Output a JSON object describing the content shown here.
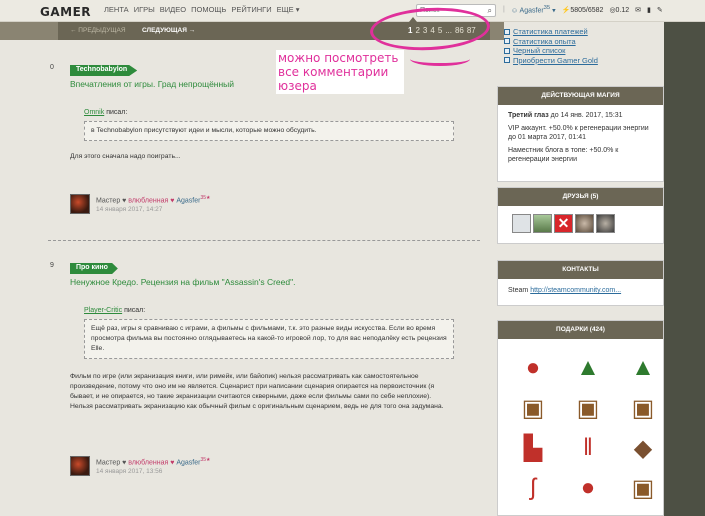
{
  "header": {
    "logo": "GAMER",
    "nav": [
      "ЛЕНТА",
      "ИГРЫ",
      "ВИДЕО",
      "ПОМОЩЬ",
      "РЕЙТИНГИ",
      "ЕЩЕ"
    ],
    "search_placeholder": "Поиск",
    "user": "Agasfer",
    "user_level": "35",
    "counter": "5805/6582",
    "balance": "0.12"
  },
  "pager": {
    "prev": "← ПРЕДЫДУЩАЯ",
    "next": "СЛЕДУЮЩАЯ →",
    "pages": [
      "1",
      "2",
      "3",
      "4",
      "5",
      "...",
      "86",
      "87"
    ],
    "current": "1"
  },
  "annotation": "можно посмотреть все комментарии юзера",
  "posts": [
    {
      "count": "0",
      "tag": "Technobabylon",
      "title": "Впечатления от игры. Град непрощённый",
      "quote_author": "Omnik",
      "wrote": "писал:",
      "quote": "в Technobabylon присутствуют идеи и мысли, которые можно обсудить.",
      "body": "Для этого сначала надо поиграть...",
      "sig_prefix": "Мастер ♥",
      "sig_love": "влюбленная ♥",
      "sig_name": "Agasfer",
      "sig_level": "35",
      "date": "14 января 2017, 14:27"
    },
    {
      "count": "9",
      "tag": "Про кино",
      "title": "Ненужное Кредо. Рецензия на фильм \"Assassin's Creed\".",
      "quote_author": "Player-Critic",
      "wrote": "писал:",
      "quote": "Ещё раз, игры я сравниваю с играми, а фильмы с фильмами, т.к. это разные виды искусства. Если во время просмотра фильма вы постоянно оглядываетесь на какой-то игровой лор, то для вас неподалёку есть рецензия Elle.",
      "body": "Фильм по игре (или экранизация книги, или римейк, или байопик) нельзя рассматривать как самостоятельное произведение, потому что оно им не является. Сценарист при написании сценария опирается на первоисточник (я бывает, и не опирается, но такие экранизации считаются скверными, даже если фильмы сами по себе неплохие). Нельзя рассматривать экранизацию как обычный фильм с оригинальным сценарием, ведь не для того она задумана.",
      "sig_prefix": "Мастер ♥",
      "sig_love": "влюбленная ♥",
      "sig_name": "Agasfer",
      "sig_level": "35",
      "date": "14 января 2017, 13:56"
    }
  ],
  "sidebar": {
    "links": [
      "Статистика платежей",
      "Статистика опыта",
      "Черный список",
      "Приобрести Gamer Gold"
    ],
    "magic_title": "ДЕЙСТВУЮЩАЯ МАГИЯ",
    "magic": [
      {
        "bold": "Третий глаз",
        "text": " до 14 янв. 2017, 15:31"
      },
      {
        "bold": "",
        "text": "VIP аккаунт. +50.0% к регенерации энергии до 01 марта 2017, 01:41"
      },
      {
        "bold": "",
        "text": "Наместник блога в топе: +50.0% к регенерации энергии"
      }
    ],
    "friends_title": "ДРУЗЬЯ (5)",
    "contacts_title": "КОНТАКТЫ",
    "steam_label": "Steam",
    "steam_link": "http://steamcommunity.com...",
    "gifts_title": "ПОДАРКИ (424)"
  },
  "colors": {
    "accent_green": "#2e8b3c",
    "pager_bg": "#6b6655",
    "annotation": "#e0309b"
  }
}
